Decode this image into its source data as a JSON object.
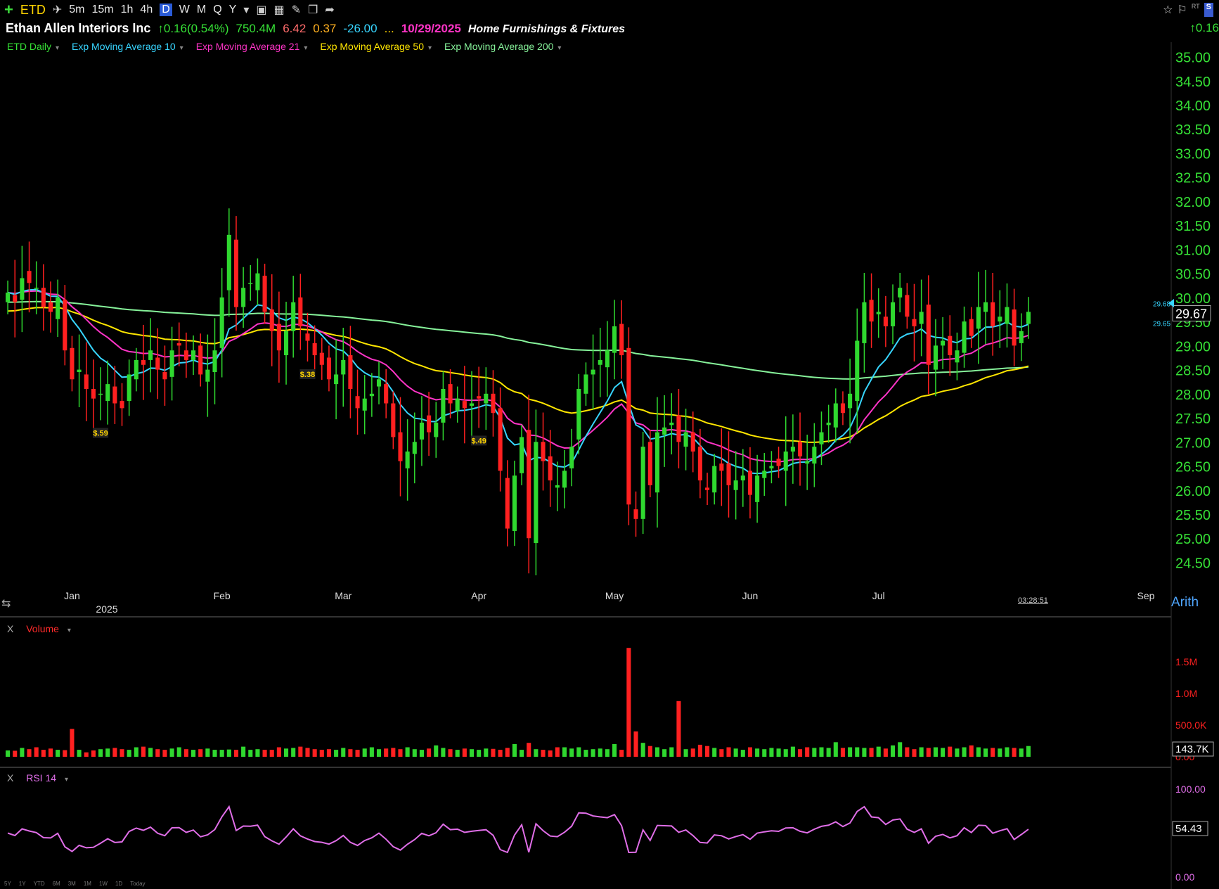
{
  "toolbar": {
    "add_label": "+",
    "symbol": "ETD",
    "intervals": [
      "5m",
      "15m",
      "1h",
      "4h",
      "D",
      "W",
      "M",
      "Q",
      "Y"
    ],
    "active_interval": "D",
    "dropdown_glyph": "▾",
    "right_rt": "RT",
    "right_s": "S"
  },
  "info": {
    "name": "Ethan Allen Interiors Inc",
    "change": "↑0.16(0.54%)",
    "volume": "750.4M",
    "v1": "6.42",
    "v2": "0.37",
    "v3": "-26.00",
    "ellipsis": "...",
    "date": "10/29/2025",
    "industry": "Home Furnishings & Fixtures",
    "right_change": "↑0.16"
  },
  "legend": {
    "items": [
      {
        "label": "ETD Daily",
        "color": "#36e036"
      },
      {
        "label": "Exp Moving Average 10",
        "color": "#37d5ff"
      },
      {
        "label": "Exp Moving Average 21",
        "color": "#ff34c7"
      },
      {
        "label": "Exp Moving Average 50",
        "color": "#ffe600"
      },
      {
        "label": "Exp Moving Average 200",
        "color": "#86f29a"
      }
    ]
  },
  "panes": {
    "volume_label": "Volume",
    "rsi_label": "RSI 14",
    "close_x": "X",
    "timer": "03:28:51",
    "scale_mode": "Arith",
    "periods": [
      "5Y",
      "1Y",
      "YTD",
      "6M",
      "3M",
      "1M",
      "1W",
      "1D",
      "Today"
    ]
  },
  "chart_data": [
    {
      "type": "candlestick",
      "title": "Ethan Allen Interiors Inc",
      "ylim": [
        24.2,
        35.3
      ],
      "y_ticks": [
        35.0,
        34.5,
        34.0,
        33.5,
        33.0,
        32.5,
        32.0,
        31.5,
        31.0,
        30.5,
        30.0,
        29.5,
        29.0,
        28.5,
        28.0,
        27.5,
        27.0,
        26.5,
        26.0,
        25.5,
        25.0,
        24.5
      ],
      "y_tick_labels": [
        "35.00",
        "34.50",
        "34.00",
        "33.50",
        "33.00",
        "32.50",
        "32.00",
        "31.50",
        "31.00",
        "30.50",
        "30.00",
        "29.50",
        "29.00",
        "28.50",
        "28.00",
        "27.50",
        "27.00",
        "26.50",
        "26.00",
        "25.50",
        "25.00",
        "24.50"
      ],
      "x_labels": [
        "Jan",
        "Feb",
        "Mar",
        "Apr",
        "May",
        "Jun",
        "Jul",
        "Sep"
      ],
      "x_sublabel": "2025",
      "last_price": "29.67",
      "ema_side_labels": [
        "29.68",
        "29.65"
      ],
      "dividends": [
        {
          "day_index": 13,
          "label": "$.59"
        },
        {
          "day_index": 42,
          "label": "$.38"
        },
        {
          "day_index": 66,
          "label": "$.49"
        }
      ],
      "closes": [
        30.1,
        29.9,
        30.4,
        30.3,
        30.2,
        29.8,
        29.7,
        30.0,
        28.9,
        28.3,
        28.5,
        28.1,
        27.9,
        28.0,
        28.2,
        27.8,
        27.7,
        28.4,
        28.7,
        28.6,
        28.9,
        28.5,
        28.3,
        28.9,
        29.0,
        28.7,
        28.9,
        28.4,
        28.5,
        28.9,
        30.0,
        31.3,
        29.8,
        30.2,
        30.3,
        30.5,
        29.7,
        29.3,
        28.9,
        29.3,
        29.9,
        29.4,
        29.1,
        28.8,
        28.6,
        28.3,
        28.4,
        28.7,
        28.1,
        27.7,
        27.9,
        28.0,
        28.3,
        27.8,
        27.1,
        26.6,
        26.8,
        27.0,
        27.4,
        27.2,
        27.4,
        28.1,
        27.8,
        27.9,
        27.7,
        27.8,
        27.9,
        28.0,
        27.6,
        26.4,
        25.2,
        26.3,
        27.1,
        25.0,
        27.0,
        26.6,
        26.2,
        26.1,
        26.4,
        26.9,
        28.1,
        28.4,
        28.5,
        28.7,
        28.9,
        29.4,
        28.8,
        25.7,
        25.4,
        26.9,
        26.1,
        27.2,
        27.3,
        27.4,
        27.0,
        27.2,
        26.8,
        26.2,
        26.0,
        26.5,
        26.4,
        26.1,
        26.2,
        26.3,
        25.9,
        26.3,
        26.4,
        26.5,
        26.5,
        26.8,
        26.9,
        26.7,
        26.6,
        26.9,
        27.2,
        27.4,
        27.8,
        27.6,
        28.0,
        29.1,
        29.9,
        29.5,
        29.7,
        29.4,
        29.9,
        30.2,
        29.6,
        29.4,
        29.7,
        28.6,
        29.0,
        29.1,
        28.8,
        28.9,
        29.5,
        29.2,
        29.8,
        29.9,
        29.4,
        29.6,
        29.8,
        29.0,
        29.3,
        29.7
      ],
      "volumes_k": [
        100,
        95,
        140,
        120,
        150,
        110,
        130,
        110,
        105,
        440,
        110,
        70,
        100,
        120,
        130,
        140,
        120,
        110,
        150,
        160,
        140,
        120,
        110,
        130,
        150,
        120,
        110,
        120,
        130,
        110,
        110,
        115,
        110,
        160,
        110,
        120,
        110,
        110,
        150,
        130,
        140,
        160,
        140,
        120,
        110,
        120,
        110,
        140,
        120,
        110,
        130,
        150,
        120,
        130,
        140,
        120,
        150,
        120,
        110,
        130,
        180,
        140,
        120,
        110,
        130,
        120,
        110,
        130,
        125,
        110,
        140,
        200,
        110,
        220,
        120,
        110,
        100,
        150,
        150,
        130,
        150,
        110,
        120,
        130,
        120,
        200,
        110,
        1720,
        400,
        220,
        170,
        150,
        120,
        150,
        880,
        120,
        130,
        190,
        170,
        140,
        120,
        150,
        130,
        110,
        150,
        130,
        120,
        140,
        130,
        120,
        160,
        120,
        150,
        140,
        150,
        140,
        230,
        140,
        150,
        150,
        140,
        140,
        160,
        130,
        180,
        230,
        150,
        120,
        150,
        140,
        150,
        140,
        160,
        130,
        150,
        180,
        150,
        130,
        140,
        130,
        150,
        140,
        130,
        170,
        150,
        140,
        190,
        230
      ],
      "volume_ticks": [
        "1.5M",
        "1.0M",
        "500.0K",
        "0.00"
      ],
      "volume_last": "143.7K",
      "rsi_ticks": [
        "100.00",
        "0.00"
      ],
      "rsi_last": "54.43"
    }
  ],
  "colors": {
    "up": "#2fd82f",
    "down": "#ff2020",
    "ema10": "#37d5ff",
    "ema21": "#ff34c7",
    "ema50": "#ffe600",
    "ema200": "#86f29a",
    "axis_text": "#36e036",
    "rsi": "#e06ee8"
  }
}
